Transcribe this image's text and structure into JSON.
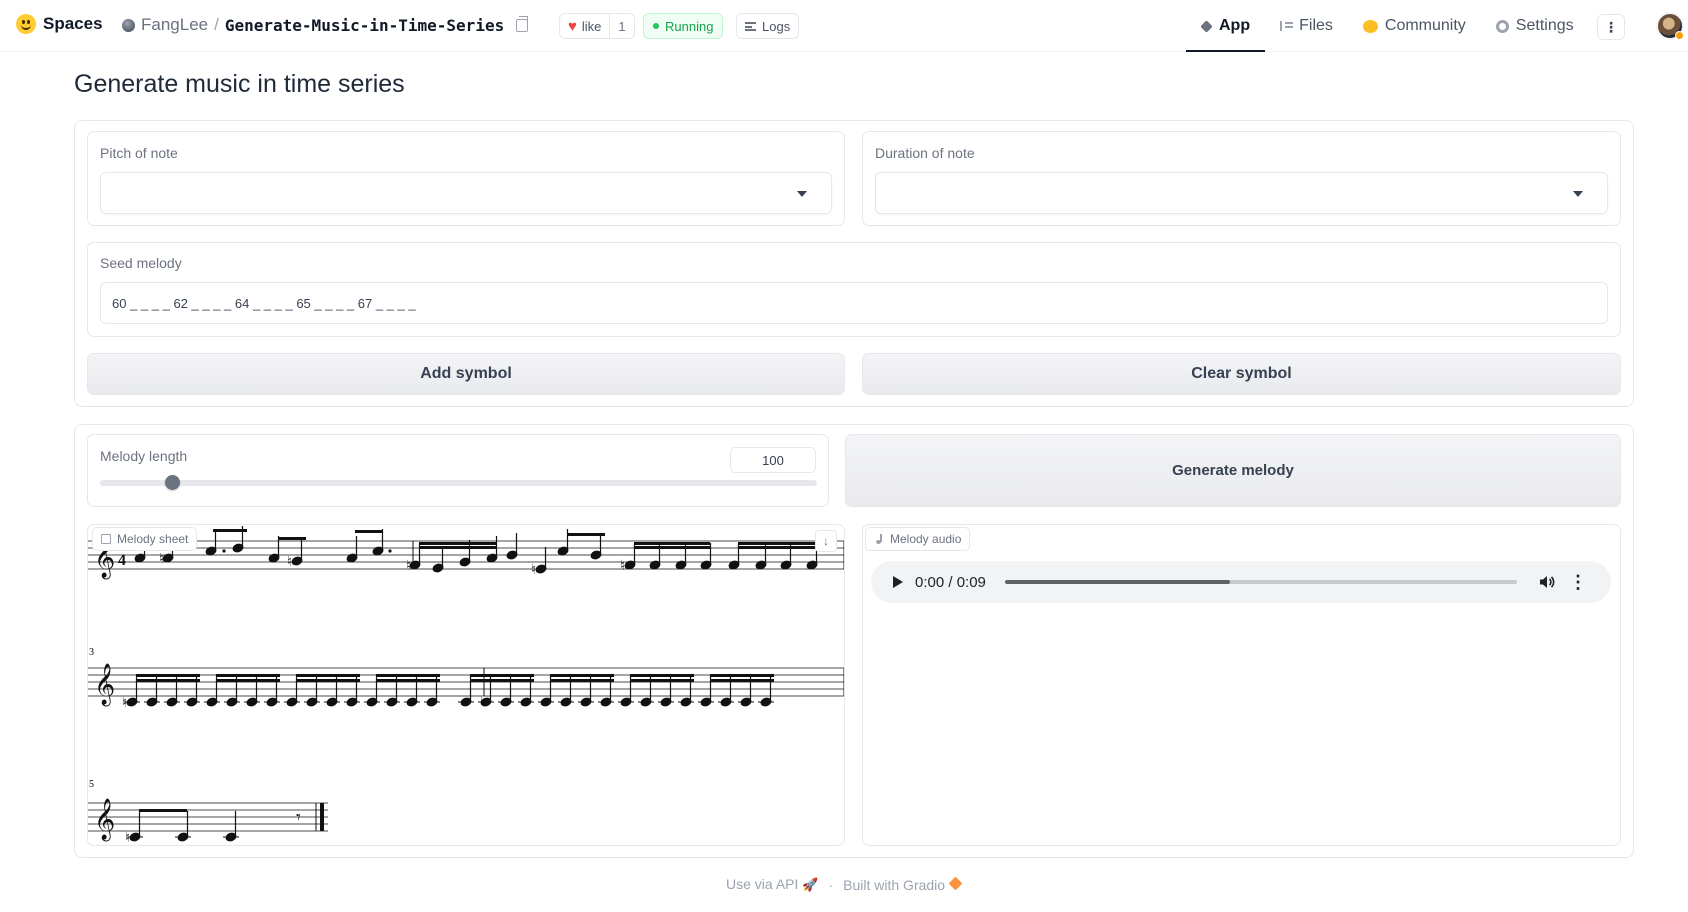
{
  "header": {
    "brand": "Spaces",
    "owner": "FangLee",
    "separator": "/",
    "repo_name": "Generate-Music-in-Time-Series",
    "like_label": "like",
    "like_count": "1",
    "status": "Running",
    "logs_label": "Logs",
    "nav": {
      "app": "App",
      "files": "Files",
      "community": "Community",
      "settings": "Settings"
    },
    "kebab": "⋮"
  },
  "main": {
    "title": "Generate music in time series",
    "pitch": {
      "label": "Pitch of note",
      "value": ""
    },
    "duration": {
      "label": "Duration of note",
      "value": ""
    },
    "seed": {
      "label": "Seed melody",
      "value": "60 _ _ _ _ 62 _ _ _ _ 64 _ _ _ _ 65 _ _ _ _ 67 _ _ _ _"
    },
    "add_symbol": "Add symbol",
    "clear_symbol": "Clear symbol",
    "melody_length": {
      "label": "Melody length",
      "value": "100",
      "min": 0,
      "max": 1000,
      "current": 100
    },
    "generate": "Generate melody",
    "sheet": {
      "label": "Melody sheet",
      "system_numbers": [
        "3",
        "5"
      ]
    },
    "audio": {
      "label": "Melody audio",
      "time": "0:00 / 0:09",
      "progress": 0.44
    }
  },
  "footer": {
    "api": "Use via API",
    "dot": "·",
    "built": "Built with Gradio"
  },
  "colors": {
    "accent_running": "#16a34a",
    "heart": "#ef4444",
    "button_bg": "#e9eaee",
    "border": "#e5e7eb"
  },
  "icons": [
    "hugging-face-logo",
    "copy-icon",
    "heart-icon",
    "logs-icon",
    "app-icon",
    "files-icon",
    "community-icon",
    "gear-icon",
    "kebab-icon",
    "chevron-down-icon",
    "image-icon",
    "download-icon",
    "music-note-icon",
    "play-icon",
    "volume-icon",
    "rocket-icon",
    "gradio-icon"
  ]
}
